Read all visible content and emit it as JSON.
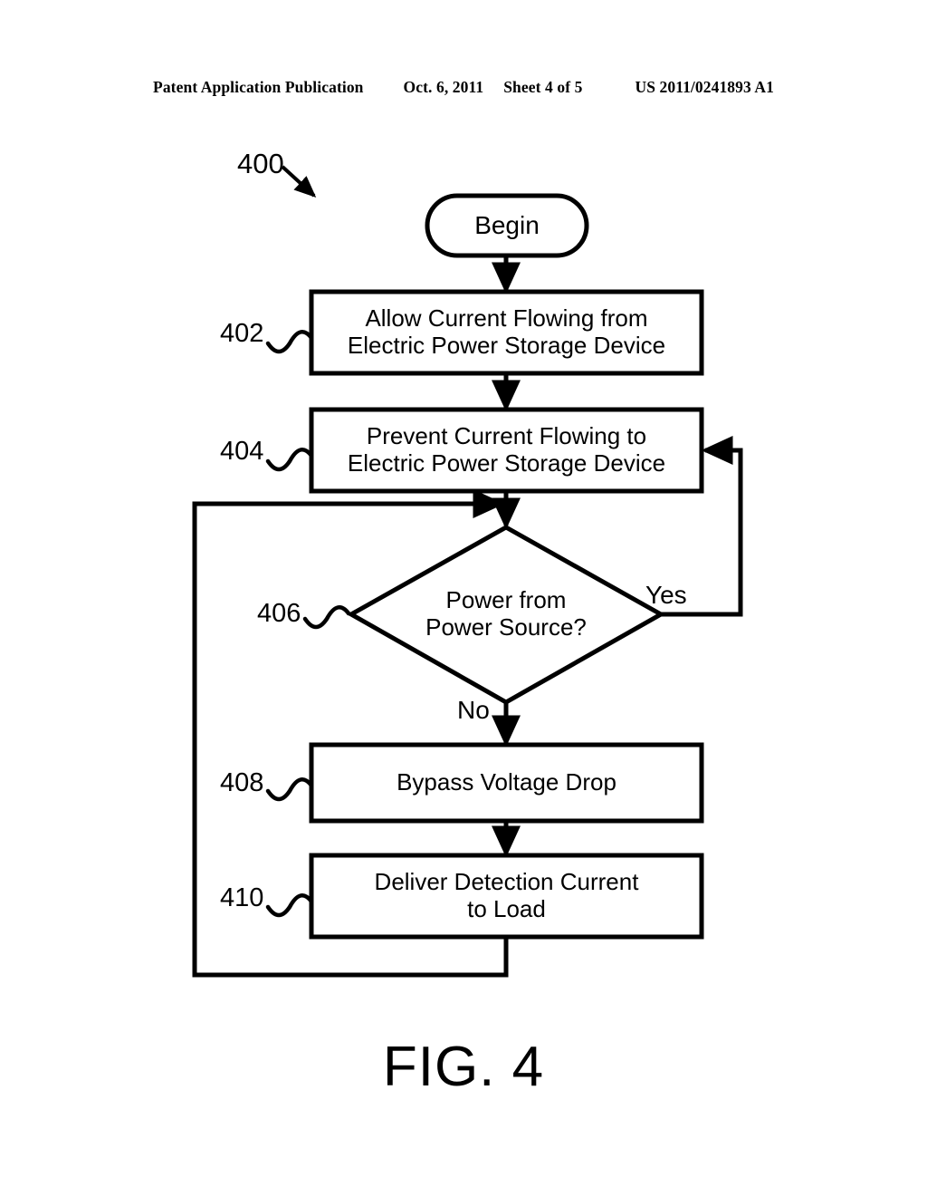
{
  "header": {
    "publication": "Patent Application Publication",
    "date": "Oct. 6, 2011",
    "sheet": "Sheet 4 of 5",
    "number": "US 2011/0241893 A1"
  },
  "figure": {
    "caption": "FIG. 4",
    "diagram_ref": "400",
    "type": "flowchart"
  },
  "flowchart": {
    "nodes": [
      {
        "id": "begin",
        "ref": "",
        "shape": "terminal",
        "label": "Begin"
      },
      {
        "id": "step-402",
        "ref": "402",
        "shape": "process",
        "label": "Allow Current Flowing from\nElectric Power Storage Device"
      },
      {
        "id": "step-404",
        "ref": "404",
        "shape": "process",
        "label": "Prevent Current Flowing to\nElectric Power Storage Device"
      },
      {
        "id": "step-406",
        "ref": "406",
        "shape": "decision",
        "label": "Power from\nPower Source?"
      },
      {
        "id": "step-408",
        "ref": "408",
        "shape": "process",
        "label": "Bypass Voltage Drop"
      },
      {
        "id": "step-410",
        "ref": "410",
        "shape": "process",
        "label": "Deliver Detection Current\nto Load"
      }
    ],
    "branch_labels": {
      "yes": "Yes",
      "no": "No"
    },
    "edges": [
      {
        "from": "begin",
        "to": "step-402",
        "label": ""
      },
      {
        "from": "step-402",
        "to": "step-404",
        "label": ""
      },
      {
        "from": "step-404",
        "to": "step-406",
        "label": ""
      },
      {
        "from": "step-406",
        "to": "step-404",
        "label": "Yes"
      },
      {
        "from": "step-406",
        "to": "step-408",
        "label": "No"
      },
      {
        "from": "step-408",
        "to": "step-410",
        "label": ""
      },
      {
        "from": "step-410",
        "to": "step-406",
        "label": ""
      }
    ]
  },
  "colors": {
    "ink": "#000000",
    "paper": "#ffffff"
  }
}
